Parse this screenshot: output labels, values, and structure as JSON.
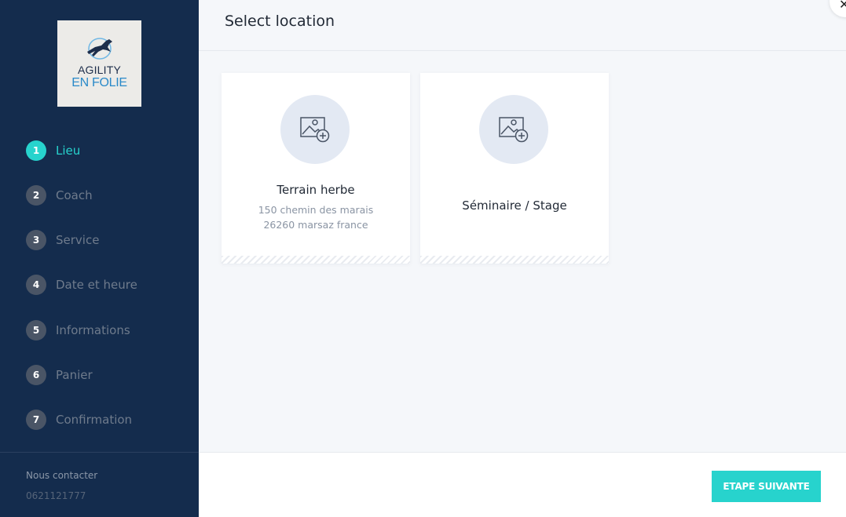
{
  "brand": {
    "logo_line1": "AGILITY",
    "logo_line2": "EN FOLIE"
  },
  "steps": [
    {
      "num": "1",
      "label": "Lieu",
      "active": true
    },
    {
      "num": "2",
      "label": "Coach"
    },
    {
      "num": "3",
      "label": "Service"
    },
    {
      "num": "4",
      "label": "Date et heure"
    },
    {
      "num": "5",
      "label": "Informations"
    },
    {
      "num": "6",
      "label": "Panier"
    },
    {
      "num": "7",
      "label": "Confirmation"
    }
  ],
  "contact": {
    "title": "Nous contacter",
    "phone": "0621121777"
  },
  "header": {
    "title": "Select location",
    "close_icon": "close-icon"
  },
  "locations": [
    {
      "name": "Terrain herbe",
      "address_line1": "150 chemin des marais",
      "address_line2": "26260 marsaz france",
      "icon": "image-add-icon"
    },
    {
      "name": "Séminaire / Stage",
      "icon": "image-add-icon"
    }
  ],
  "footer": {
    "next_label": "ETAPE SUIVANTE"
  },
  "colors": {
    "sidebar": "#142c4d",
    "accent": "#27d3cd"
  }
}
